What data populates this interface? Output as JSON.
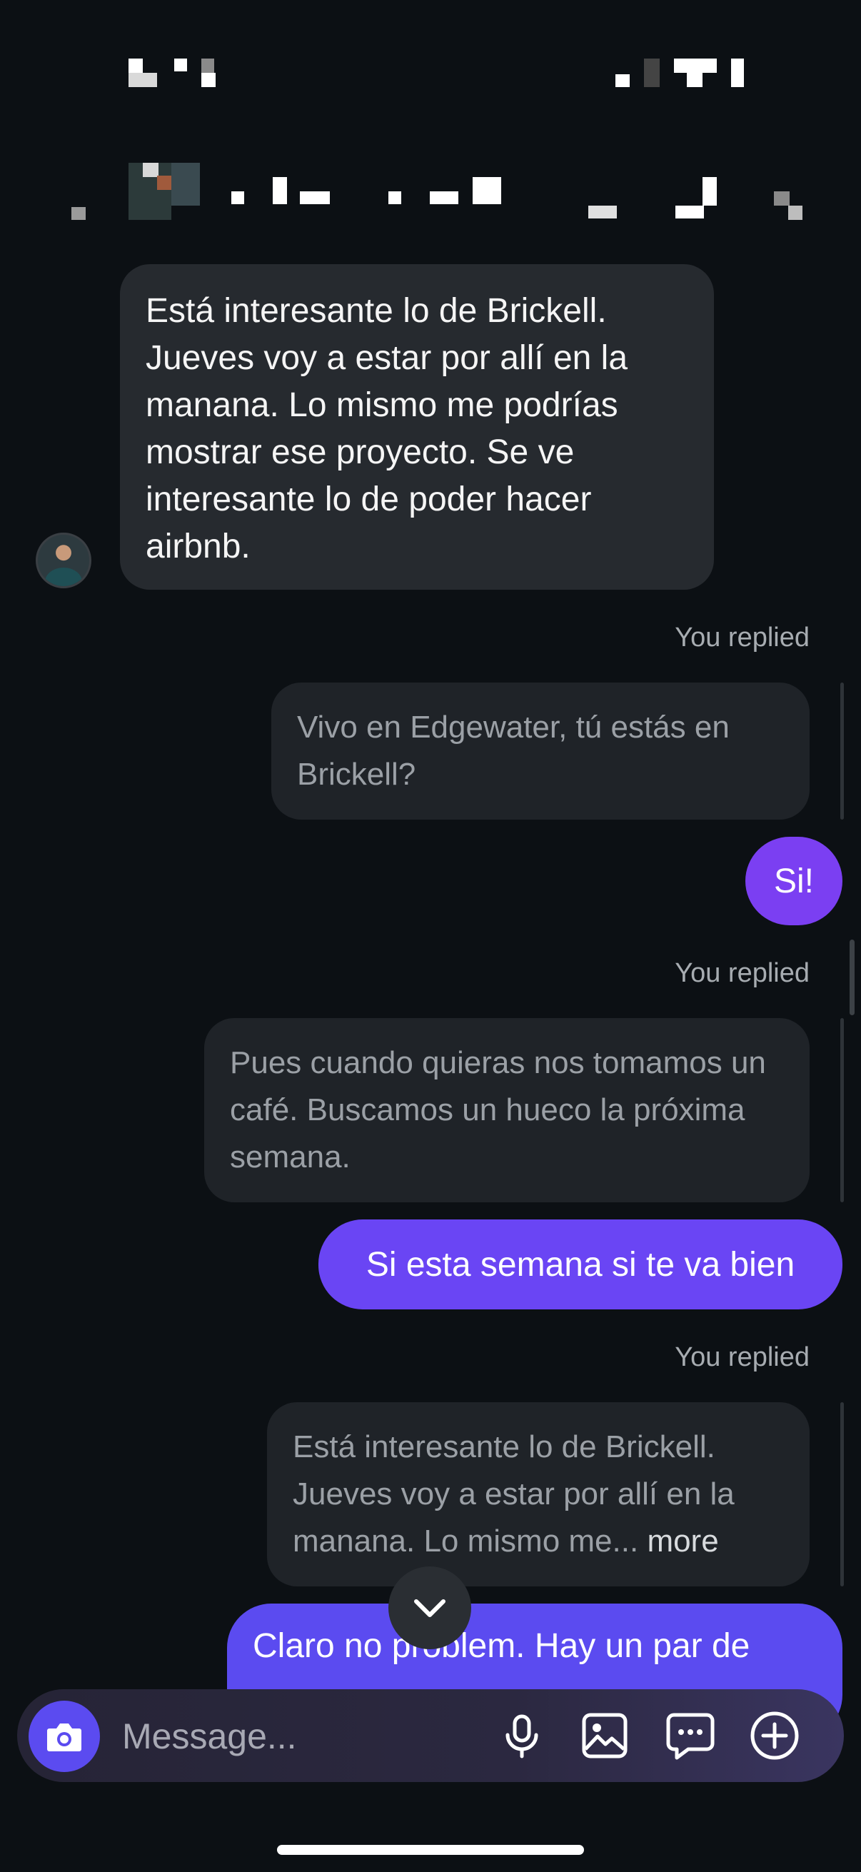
{
  "messages": {
    "incoming": {
      "text": "Está interesante lo de Brickell. Jueves voy a estar por allí en la manana. Lo mismo me podrías mostrar ese proyecto. Se ve interesante lo de poder hacer airbnb."
    },
    "replied_label": "You replied",
    "thread": [
      {
        "quote": "Vivo en Edgewater, tú estás en Brickell?",
        "reply": "Si!"
      },
      {
        "quote": "Pues cuando quieras nos tomamos un café. Buscamos un hueco la próxima semana.",
        "reply": "Si esta semana si te va bien"
      },
      {
        "quote": "Está interesante lo de Brickell. Jueves voy a estar por allí en la manana. Lo mismo me...",
        "quote_more": "more",
        "reply": "Claro no problem. Hay un par de"
      }
    ]
  },
  "composer": {
    "placeholder": "Message..."
  },
  "colors": {
    "background": "#0c1014",
    "incoming_bubble": "#262a2f",
    "quote_bubble": "#1f2328",
    "outgoing_purple": "#7b3ff2",
    "outgoing_indigo": "#5b4bf0",
    "camera_button": "#5b4bf0"
  },
  "icons": [
    "camera-icon",
    "microphone-icon",
    "gallery-icon",
    "sticker-chat-icon",
    "add-icon",
    "chevron-down-icon"
  ]
}
